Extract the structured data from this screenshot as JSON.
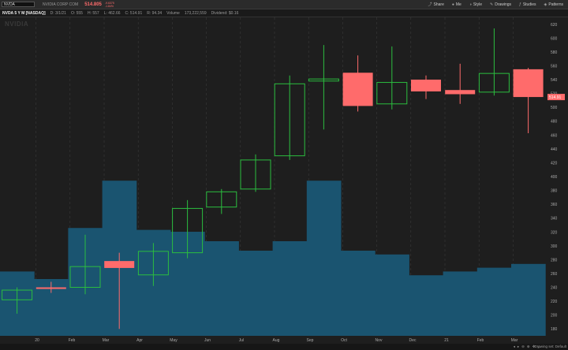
{
  "toolbar": {
    "symbol": "NVDA",
    "company": "NVIDIA CORP COM",
    "price": "514.805",
    "change_line1": "-9.6375",
    "change_line2": "-1.84%",
    "buttons": [
      {
        "label": "Share",
        "icon": "share-icon"
      },
      {
        "label": "Me",
        "icon": "user-icon"
      },
      {
        "label": "Style",
        "icon": "style-icon"
      },
      {
        "label": "Drawings",
        "icon": "pencil-icon"
      },
      {
        "label": "Studies",
        "icon": "studies-icon"
      },
      {
        "label": "Patterns",
        "icon": "patterns-icon"
      }
    ]
  },
  "ohlc": {
    "title": "NVDA 5 Y M [NASDAQ]",
    "date": "D: 3/1/21",
    "open": "O: 555",
    "high": "H: 557",
    "low": "L: 462.66",
    "close": "C: 514.91",
    "range": "R: 94.34",
    "volume_label": "Volume",
    "volume": "173,222,559",
    "dividend": "Dividend: $0.16"
  },
  "watermark": "NVIDIA",
  "bottom": {
    "drawing_set": "Drawing set: Default"
  },
  "chart_data": {
    "type": "candlestick",
    "x_labels": [
      "20",
      "Feb",
      "Mar",
      "Apr",
      "May",
      "Jun",
      "Jul",
      "Aug",
      "Sep",
      "Oct",
      "Nov",
      "Dec",
      "21",
      "Feb",
      "Mar"
    ],
    "candles": [
      {
        "open": 222,
        "high": 240,
        "low": 202,
        "close": 236,
        "up": true
      },
      {
        "open": 238,
        "high": 248,
        "low": 232,
        "close": 240,
        "up": false
      },
      {
        "open": 240,
        "high": 316,
        "low": 230,
        "close": 270,
        "up": true
      },
      {
        "open": 268,
        "high": 290,
        "low": 180,
        "close": 278,
        "up": false
      },
      {
        "open": 258,
        "high": 304,
        "low": 242,
        "close": 292,
        "up": true
      },
      {
        "open": 290,
        "high": 366,
        "low": 282,
        "close": 354,
        "up": true
      },
      {
        "open": 356,
        "high": 382,
        "low": 346,
        "close": 378,
        "up": true
      },
      {
        "open": 382,
        "high": 432,
        "low": 378,
        "close": 424,
        "up": true
      },
      {
        "open": 430,
        "high": 546,
        "low": 424,
        "close": 534,
        "up": true
      },
      {
        "open": 538,
        "high": 590,
        "low": 468,
        "close": 541,
        "up": true
      },
      {
        "open": 550,
        "high": 575,
        "low": 494,
        "close": 502,
        "up": false
      },
      {
        "open": 505,
        "high": 588,
        "low": 497,
        "close": 536,
        "up": true
      },
      {
        "open": 540,
        "high": 546,
        "low": 512,
        "close": 523,
        "up": false
      },
      {
        "open": 525,
        "high": 563,
        "low": 505,
        "close": 519,
        "up": false
      },
      {
        "open": 522,
        "high": 614,
        "low": 517,
        "close": 549,
        "up": true
      },
      {
        "open": 555,
        "high": 557,
        "low": 462.66,
        "close": 514.91,
        "up": false
      }
    ],
    "volume_relative": [
      0.34,
      0.3,
      0.57,
      0.82,
      0.56,
      0.55,
      0.5,
      0.45,
      0.5,
      0.82,
      0.45,
      0.43,
      0.32,
      0.34,
      0.36,
      0.38
    ],
    "y_ticks": [
      180,
      200,
      220,
      240,
      260,
      280,
      300,
      320,
      340,
      360,
      380,
      400,
      420,
      440,
      460,
      480,
      500,
      520,
      540,
      560,
      580,
      600,
      620
    ],
    "ylim": [
      170,
      630
    ],
    "current_price_label": "514.91",
    "colors": {
      "up": "#2bbd3f",
      "down": "#ff6b6b",
      "volume": "#1a5470",
      "grid": "#3a3a3a",
      "background": "#1e1e1e"
    }
  }
}
